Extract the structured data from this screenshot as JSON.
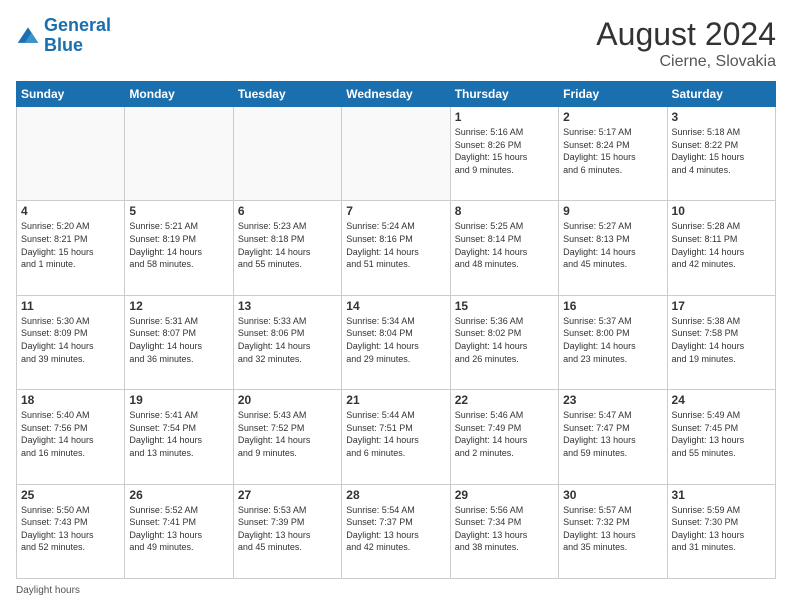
{
  "header": {
    "logo_line1": "General",
    "logo_line2": "Blue",
    "month_year": "August 2024",
    "location": "Cierne, Slovakia"
  },
  "footer": {
    "daylight_label": "Daylight hours"
  },
  "weekdays": [
    "Sunday",
    "Monday",
    "Tuesday",
    "Wednesday",
    "Thursday",
    "Friday",
    "Saturday"
  ],
  "weeks": [
    [
      {
        "num": "",
        "info": ""
      },
      {
        "num": "",
        "info": ""
      },
      {
        "num": "",
        "info": ""
      },
      {
        "num": "",
        "info": ""
      },
      {
        "num": "1",
        "info": "Sunrise: 5:16 AM\nSunset: 8:26 PM\nDaylight: 15 hours\nand 9 minutes."
      },
      {
        "num": "2",
        "info": "Sunrise: 5:17 AM\nSunset: 8:24 PM\nDaylight: 15 hours\nand 6 minutes."
      },
      {
        "num": "3",
        "info": "Sunrise: 5:18 AM\nSunset: 8:22 PM\nDaylight: 15 hours\nand 4 minutes."
      }
    ],
    [
      {
        "num": "4",
        "info": "Sunrise: 5:20 AM\nSunset: 8:21 PM\nDaylight: 15 hours\nand 1 minute."
      },
      {
        "num": "5",
        "info": "Sunrise: 5:21 AM\nSunset: 8:19 PM\nDaylight: 14 hours\nand 58 minutes."
      },
      {
        "num": "6",
        "info": "Sunrise: 5:23 AM\nSunset: 8:18 PM\nDaylight: 14 hours\nand 55 minutes."
      },
      {
        "num": "7",
        "info": "Sunrise: 5:24 AM\nSunset: 8:16 PM\nDaylight: 14 hours\nand 51 minutes."
      },
      {
        "num": "8",
        "info": "Sunrise: 5:25 AM\nSunset: 8:14 PM\nDaylight: 14 hours\nand 48 minutes."
      },
      {
        "num": "9",
        "info": "Sunrise: 5:27 AM\nSunset: 8:13 PM\nDaylight: 14 hours\nand 45 minutes."
      },
      {
        "num": "10",
        "info": "Sunrise: 5:28 AM\nSunset: 8:11 PM\nDaylight: 14 hours\nand 42 minutes."
      }
    ],
    [
      {
        "num": "11",
        "info": "Sunrise: 5:30 AM\nSunset: 8:09 PM\nDaylight: 14 hours\nand 39 minutes."
      },
      {
        "num": "12",
        "info": "Sunrise: 5:31 AM\nSunset: 8:07 PM\nDaylight: 14 hours\nand 36 minutes."
      },
      {
        "num": "13",
        "info": "Sunrise: 5:33 AM\nSunset: 8:06 PM\nDaylight: 14 hours\nand 32 minutes."
      },
      {
        "num": "14",
        "info": "Sunrise: 5:34 AM\nSunset: 8:04 PM\nDaylight: 14 hours\nand 29 minutes."
      },
      {
        "num": "15",
        "info": "Sunrise: 5:36 AM\nSunset: 8:02 PM\nDaylight: 14 hours\nand 26 minutes."
      },
      {
        "num": "16",
        "info": "Sunrise: 5:37 AM\nSunset: 8:00 PM\nDaylight: 14 hours\nand 23 minutes."
      },
      {
        "num": "17",
        "info": "Sunrise: 5:38 AM\nSunset: 7:58 PM\nDaylight: 14 hours\nand 19 minutes."
      }
    ],
    [
      {
        "num": "18",
        "info": "Sunrise: 5:40 AM\nSunset: 7:56 PM\nDaylight: 14 hours\nand 16 minutes."
      },
      {
        "num": "19",
        "info": "Sunrise: 5:41 AM\nSunset: 7:54 PM\nDaylight: 14 hours\nand 13 minutes."
      },
      {
        "num": "20",
        "info": "Sunrise: 5:43 AM\nSunset: 7:52 PM\nDaylight: 14 hours\nand 9 minutes."
      },
      {
        "num": "21",
        "info": "Sunrise: 5:44 AM\nSunset: 7:51 PM\nDaylight: 14 hours\nand 6 minutes."
      },
      {
        "num": "22",
        "info": "Sunrise: 5:46 AM\nSunset: 7:49 PM\nDaylight: 14 hours\nand 2 minutes."
      },
      {
        "num": "23",
        "info": "Sunrise: 5:47 AM\nSunset: 7:47 PM\nDaylight: 13 hours\nand 59 minutes."
      },
      {
        "num": "24",
        "info": "Sunrise: 5:49 AM\nSunset: 7:45 PM\nDaylight: 13 hours\nand 55 minutes."
      }
    ],
    [
      {
        "num": "25",
        "info": "Sunrise: 5:50 AM\nSunset: 7:43 PM\nDaylight: 13 hours\nand 52 minutes."
      },
      {
        "num": "26",
        "info": "Sunrise: 5:52 AM\nSunset: 7:41 PM\nDaylight: 13 hours\nand 49 minutes."
      },
      {
        "num": "27",
        "info": "Sunrise: 5:53 AM\nSunset: 7:39 PM\nDaylight: 13 hours\nand 45 minutes."
      },
      {
        "num": "28",
        "info": "Sunrise: 5:54 AM\nSunset: 7:37 PM\nDaylight: 13 hours\nand 42 minutes."
      },
      {
        "num": "29",
        "info": "Sunrise: 5:56 AM\nSunset: 7:34 PM\nDaylight: 13 hours\nand 38 minutes."
      },
      {
        "num": "30",
        "info": "Sunrise: 5:57 AM\nSunset: 7:32 PM\nDaylight: 13 hours\nand 35 minutes."
      },
      {
        "num": "31",
        "info": "Sunrise: 5:59 AM\nSunset: 7:30 PM\nDaylight: 13 hours\nand 31 minutes."
      }
    ]
  ]
}
